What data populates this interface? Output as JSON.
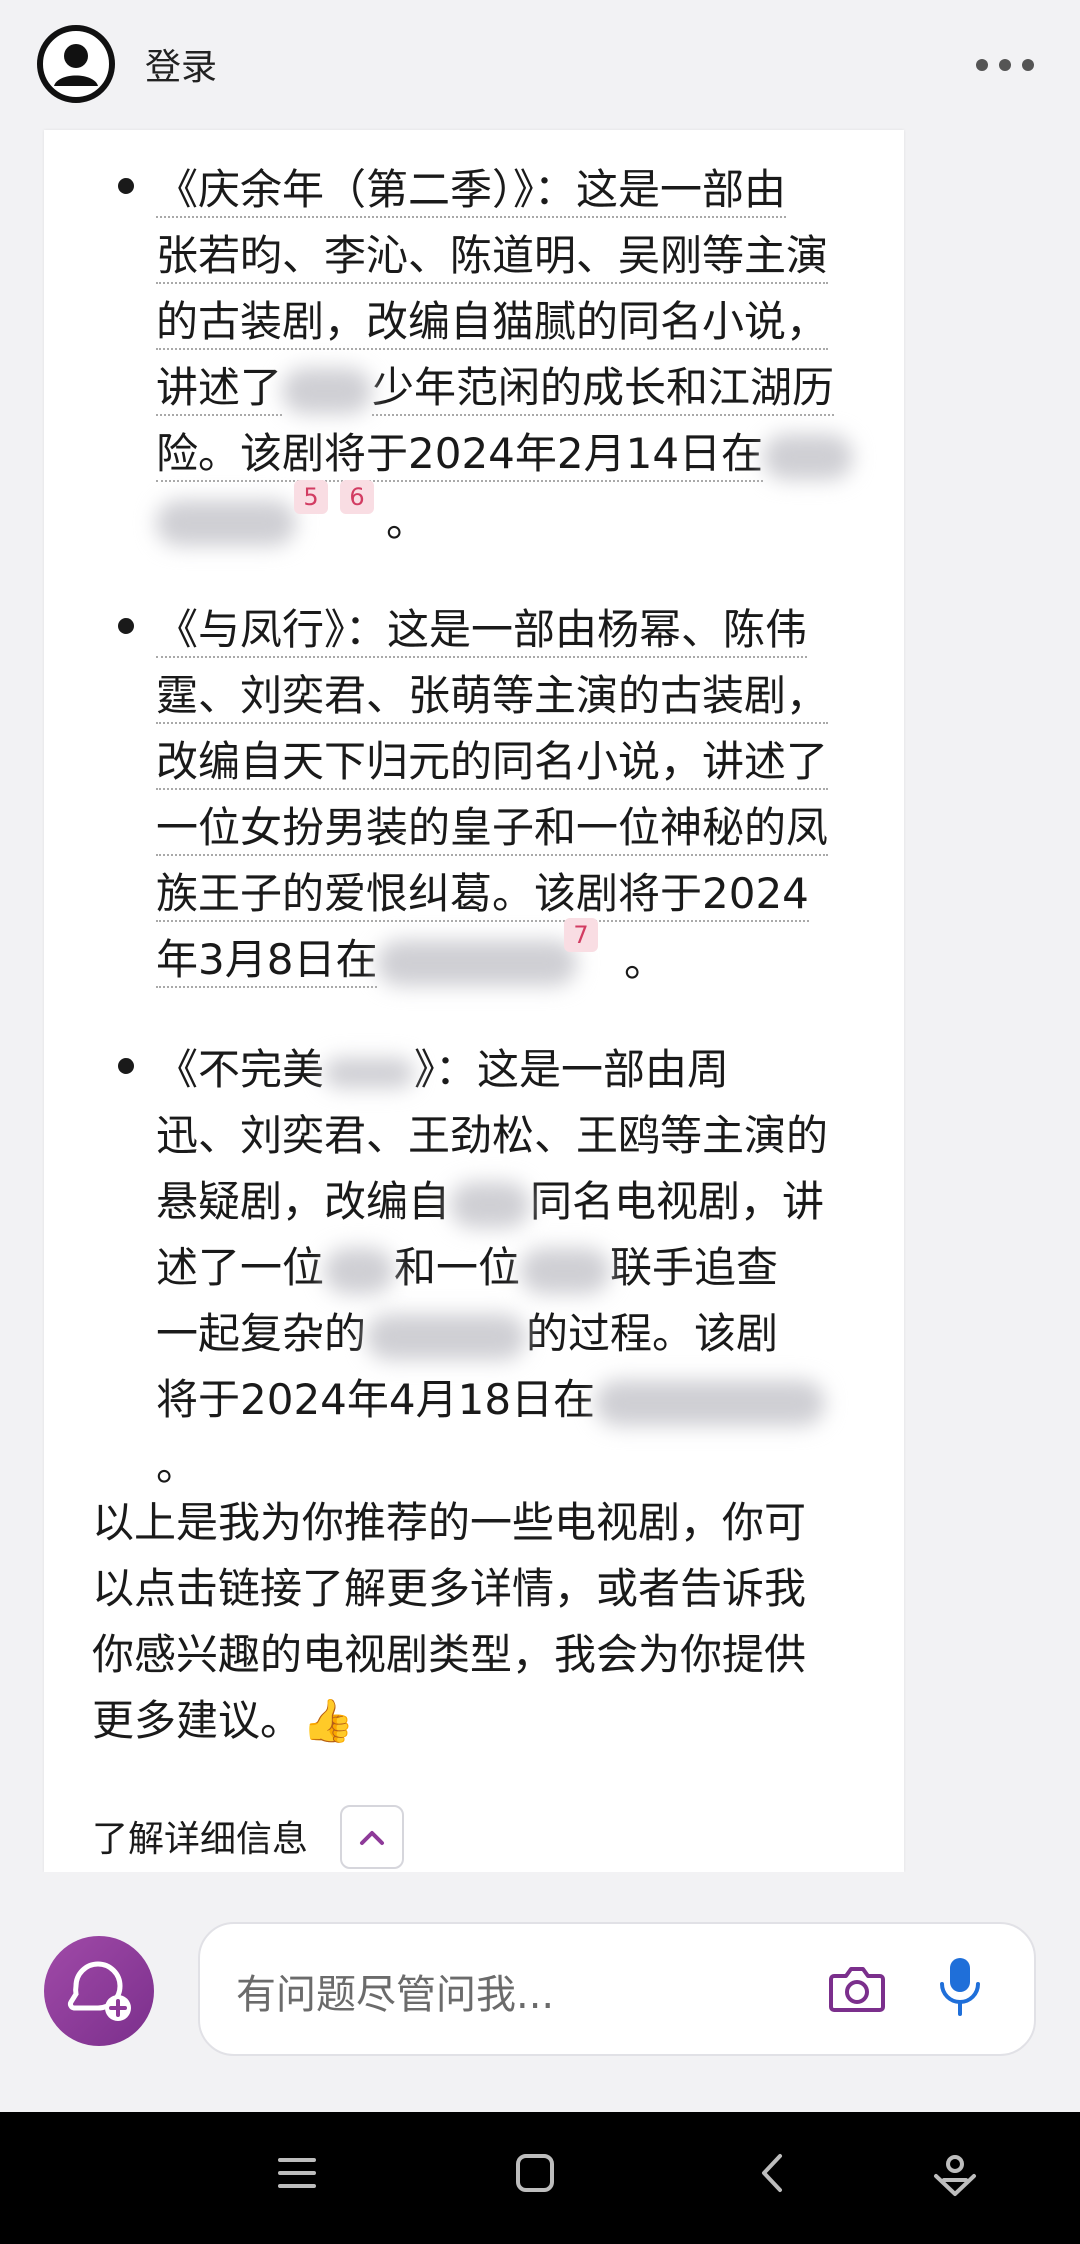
{
  "header": {
    "login_label": "登录"
  },
  "items": [
    {
      "lines": [
        "《庆余年（第二季）》：这是一部由",
        "张若昀、李沁、陈道明、吴刚等主演",
        "的古装剧，改编自猫腻的同名小说，",
        "讲述了",
        "少年范闲的成长和江湖历",
        "险。该剧将于2024年2月14日在",
        "。"
      ],
      "badges": [
        "5",
        "6"
      ]
    },
    {
      "lines": [
        "《与凤行》：这是一部由杨幂、陈伟",
        "霆、刘奕君、张萌等主演的古装剧，",
        "改编自天下归元的同名小说，讲述了",
        "一位女扮男装的皇子和一位神秘的凤",
        "族王子的爱恨纠葛。该剧将于2024",
        "年3月8日在",
        "。"
      ],
      "badges": [
        "7"
      ]
    },
    {
      "lines": [
        "《不完美",
        "》：这是一部由周",
        "迅、刘奕君、王劲松、王鸥等主演的",
        "悬疑剧，改编自",
        "同名电视剧，讲",
        "述了一位",
        "和一位",
        "联手追查",
        "一起复杂的",
        "的过程。该剧",
        "将于2024年4月18日在",
        "。"
      ]
    }
  ],
  "closing_paragraph": [
    "以上是我为你推荐的一些电视剧，你可",
    "以点击链接了解更多详情，或者告诉我",
    "你感兴趣的电视剧类型，我会为你提供",
    "更多建议。👍"
  ],
  "more_info_label": "了解详细信息",
  "input": {
    "placeholder": "有问题尽管问我..."
  },
  "colors": {
    "accent": "#8e3a99",
    "mic": "#1f6fd9",
    "badge_bg": "#f9dde3",
    "badge_text": "#d23c62"
  },
  "icons": {
    "avatar": "user-avatar-icon",
    "more": "more-dots-icon",
    "new_chat": "new-chat-icon",
    "camera": "camera-icon",
    "mic": "microphone-icon",
    "chevron": "chevron-up-icon",
    "nav_menu": "menu-icon",
    "nav_home": "home-square-icon",
    "nav_back": "back-icon",
    "nav_assistant": "assistant-icon"
  }
}
